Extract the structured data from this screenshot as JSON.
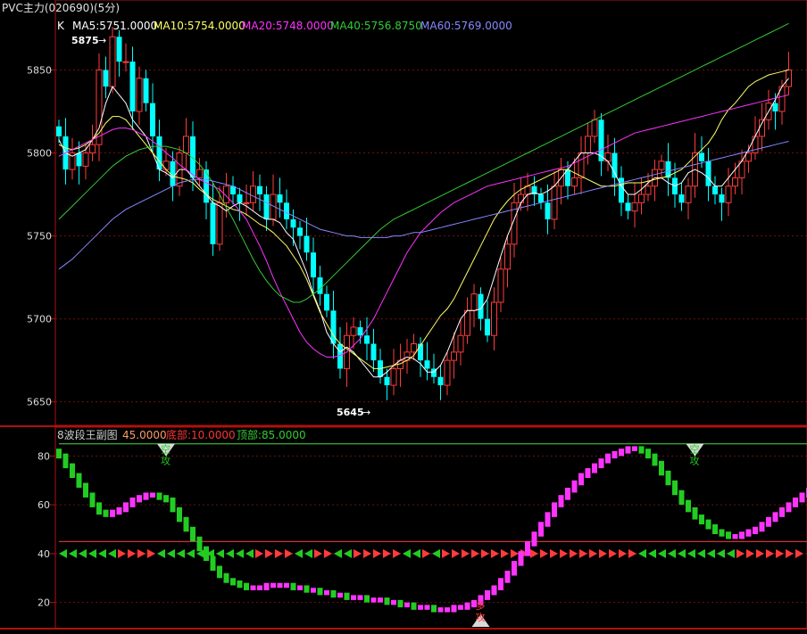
{
  "title": "PVC主力(020690)(5分)",
  "colors": {
    "up": "#ff3b3b",
    "down": "#00ffff",
    "frame": "#b01010",
    "grid": "#6e1010",
    "ma5": "#ffffff",
    "ma10": "#ffff66",
    "ma20": "#ff33ff",
    "ma40": "#33cc33",
    "ma60": "#8888ff",
    "bull": "#ff33ff",
    "bear": "#22cc22",
    "level_line": "#ff4444",
    "top_line": "#44dd44"
  },
  "main_panel": {
    "k_label": "K",
    "ma_legend": [
      {
        "text": "MA5:5751.0000",
        "color": "#ffffff"
      },
      {
        "text": "MA10:5754.0000",
        "color": "#ffff66"
      },
      {
        "text": "MA20:5748.0000",
        "color": "#ff33ff"
      },
      {
        "text": "MA40:5756.8750",
        "color": "#33cc33"
      },
      {
        "text": "MA60:5769.0000",
        "color": "#8888ff"
      }
    ],
    "high_marker": "5875",
    "low_marker": "5645"
  },
  "sub_panel": {
    "legend": [
      {
        "text": "8波段王副图",
        "color": "#cccccc"
      },
      {
        "text": "45.0000",
        "color": "#ff9966"
      },
      {
        "text": "底部:10.0000",
        "color": "#ff3333"
      },
      {
        "text": "顶部:85.0000",
        "color": "#33cc33"
      }
    ],
    "signals": [
      {
        "text": "空攻",
        "type": "top",
        "at_bar": 16
      },
      {
        "text": "空攻",
        "type": "top",
        "at_bar": 95
      },
      {
        "text": "多攻",
        "type": "bottom",
        "at_bar": 63
      },
      {
        "text": "多攻",
        "type": "bottom",
        "at_bar": 114
      }
    ]
  },
  "chart_data": [
    {
      "type": "candlestick",
      "title": "PVC主力(020690)(5分)",
      "y_ticks": [
        5650,
        5700,
        5750,
        5800,
        5850
      ],
      "ylim": [
        5638,
        5890
      ],
      "grid": true,
      "ohlc_note": "close prices per bar; open = previous close",
      "close": [
        5810,
        5790,
        5800,
        5792,
        5800,
        5805,
        5850,
        5840,
        5870,
        5855,
        5855,
        5825,
        5845,
        5830,
        5810,
        5790,
        5795,
        5780,
        5800,
        5810,
        5785,
        5790,
        5770,
        5745,
        5770,
        5780,
        5775,
        5770,
        5770,
        5780,
        5775,
        5760,
        5775,
        5770,
        5760,
        5755,
        5750,
        5740,
        5725,
        5715,
        5705,
        5685,
        5670,
        5690,
        5695,
        5690,
        5685,
        5675,
        5665,
        5660,
        5670,
        5675,
        5680,
        5685,
        5675,
        5670,
        5665,
        5660,
        5675,
        5680,
        5690,
        5705,
        5715,
        5700,
        5690,
        5710,
        5730,
        5745,
        5770,
        5775,
        5780,
        5775,
        5770,
        5760,
        5780,
        5790,
        5780,
        5785,
        5800,
        5810,
        5820,
        5795,
        5800,
        5785,
        5770,
        5765,
        5770,
        5775,
        5780,
        5790,
        5795,
        5785,
        5775,
        5770,
        5780,
        5800,
        5795,
        5780,
        5775,
        5770,
        5780,
        5785,
        5795,
        5800,
        5810,
        5820,
        5830,
        5825,
        5840,
        5850
      ],
      "ma5": [
        5808,
        5800,
        5798,
        5800,
        5802,
        5808,
        5815,
        5830,
        5840,
        5835,
        5830,
        5820,
        5815,
        5810,
        5800,
        5790,
        5788,
        5785,
        5790,
        5790,
        5785,
        5780,
        5775,
        5770,
        5768,
        5765,
        5768,
        5770,
        5768,
        5765,
        5762,
        5760,
        5760,
        5758,
        5752,
        5748,
        5738,
        5728,
        5715,
        5705,
        5692,
        5685,
        5680,
        5683,
        5680,
        5675,
        5670,
        5665,
        5665,
        5668,
        5672,
        5675,
        5677,
        5676,
        5673,
        5668,
        5668,
        5672,
        5680,
        5690,
        5700,
        5705,
        5705,
        5706,
        5712,
        5725,
        5738,
        5750,
        5760,
        5770,
        5775,
        5776,
        5775,
        5777,
        5780,
        5785,
        5790,
        5795,
        5800,
        5800,
        5800,
        5798,
        5795,
        5788,
        5780,
        5775,
        5775,
        5778,
        5782,
        5785,
        5785,
        5782,
        5780,
        5782,
        5788,
        5790,
        5788,
        5785,
        5780,
        5780,
        5785,
        5790,
        5795,
        5802,
        5810,
        5818,
        5825,
        5832,
        5840,
        5845
      ],
      "ma10": [
        5805,
        5803,
        5802,
        5803,
        5805,
        5808,
        5812,
        5818,
        5822,
        5822,
        5820,
        5815,
        5810,
        5805,
        5800,
        5795,
        5790,
        5786,
        5785,
        5784,
        5782,
        5778,
        5775,
        5772,
        5770,
        5768,
        5766,
        5765,
        5763,
        5760,
        5757,
        5755,
        5752,
        5748,
        5744,
        5738,
        5732,
        5724,
        5714,
        5704,
        5697,
        5690,
        5685,
        5682,
        5679,
        5676,
        5673,
        5670,
        5670,
        5671,
        5672,
        5673,
        5675,
        5678,
        5684,
        5690,
        5696,
        5702,
        5706,
        5712,
        5720,
        5728,
        5736,
        5744,
        5752,
        5760,
        5766,
        5771,
        5775,
        5778,
        5780,
        5782,
        5784,
        5786,
        5788,
        5790,
        5790,
        5788,
        5786,
        5784,
        5782,
        5780,
        5780,
        5780,
        5781,
        5782,
        5782,
        5782,
        5783,
        5784,
        5785,
        5786,
        5788,
        5790,
        5794,
        5798,
        5802,
        5806,
        5812,
        5820,
        5826,
        5830,
        5835,
        5840,
        5843,
        5845,
        5847,
        5848,
        5849,
        5850
      ],
      "ma20": [
        5798,
        5800,
        5802,
        5804,
        5806,
        5808,
        5810,
        5812,
        5814,
        5815,
        5815,
        5814,
        5812,
        5810,
        5807,
        5804,
        5800,
        5797,
        5793,
        5790,
        5787,
        5784,
        5782,
        5780,
        5778,
        5774,
        5770,
        5765,
        5760,
        5752,
        5744,
        5735,
        5725,
        5716,
        5708,
        5700,
        5692,
        5686,
        5682,
        5679,
        5677,
        5677,
        5678,
        5680,
        5684,
        5688,
        5694,
        5700,
        5708,
        5716,
        5724,
        5732,
        5740,
        5746,
        5752,
        5756,
        5760,
        5764,
        5767,
        5770,
        5772,
        5774,
        5776,
        5778,
        5780,
        5781,
        5782,
        5783,
        5784,
        5785,
        5786,
        5787,
        5788,
        5789,
        5790,
        5791,
        5792,
        5794,
        5796,
        5798,
        5800,
        5802,
        5804,
        5806,
        5808,
        5810,
        5812,
        5813,
        5814,
        5815,
        5816,
        5817,
        5818,
        5819,
        5820,
        5821,
        5822,
        5823,
        5824,
        5825,
        5826,
        5827,
        5828,
        5829,
        5830,
        5831,
        5832,
        5833,
        5834,
        5835
      ],
      "ma40": [
        5760,
        5764,
        5768,
        5772,
        5776,
        5780,
        5784,
        5788,
        5792,
        5795,
        5798,
        5800,
        5802,
        5803,
        5804,
        5804,
        5804,
        5803,
        5802,
        5800,
        5797,
        5793,
        5788,
        5782,
        5775,
        5767,
        5760,
        5752,
        5744,
        5736,
        5729,
        5723,
        5718,
        5714,
        5712,
        5710,
        5710,
        5712,
        5715,
        5718,
        5722,
        5726,
        5730,
        5734,
        5738,
        5742,
        5746,
        5750,
        5754,
        5757,
        5760,
        5762,
        5764,
        5766,
        5768,
        5770,
        5772,
        5774,
        5776,
        5778,
        5780,
        5782,
        5784,
        5786,
        5788,
        5790,
        5792,
        5794,
        5796,
        5798,
        5800,
        5802,
        5804,
        5806,
        5808,
        5810,
        5812,
        5814,
        5816,
        5818,
        5820,
        5822,
        5824,
        5826,
        5828,
        5830,
        5832,
        5834,
        5836,
        5838,
        5840,
        5842,
        5844,
        5846,
        5848,
        5850,
        5852,
        5854,
        5856,
        5858,
        5860,
        5862,
        5864,
        5866,
        5868,
        5870,
        5872,
        5874,
        5876,
        5878
      ],
      "ma60": [
        5730,
        5733,
        5736,
        5740,
        5744,
        5748,
        5752,
        5756,
        5760,
        5763,
        5766,
        5768,
        5770,
        5772,
        5774,
        5776,
        5778,
        5780,
        5782,
        5783,
        5784,
        5784,
        5784,
        5783,
        5782,
        5781,
        5780,
        5778,
        5776,
        5774,
        5772,
        5770,
        5768,
        5766,
        5764,
        5762,
        5760,
        5758,
        5756,
        5754,
        5753,
        5752,
        5751,
        5750,
        5750,
        5749,
        5749,
        5749,
        5749,
        5749,
        5750,
        5750,
        5751,
        5752,
        5752,
        5753,
        5754,
        5755,
        5756,
        5757,
        5758,
        5759,
        5760,
        5761,
        5762,
        5763,
        5764,
        5765,
        5766,
        5767,
        5768,
        5769,
        5770,
        5771,
        5772,
        5773,
        5774,
        5775,
        5776,
        5777,
        5778,
        5779,
        5780,
        5781,
        5782,
        5783,
        5784,
        5785,
        5786,
        5787,
        5788,
        5789,
        5790,
        5791,
        5792,
        5793,
        5794,
        5795,
        5796,
        5797,
        5798,
        5799,
        5800,
        5801,
        5802,
        5803,
        5804,
        5805,
        5806,
        5807
      ]
    },
    {
      "type": "bar",
      "title": "8波段王副图",
      "y_ticks": [
        20,
        40,
        60,
        80
      ],
      "ylim": [
        10,
        90
      ],
      "reference_lines": [
        45,
        85
      ],
      "values": [
        80,
        76,
        72,
        68,
        64,
        60,
        57,
        56,
        57,
        58,
        60,
        62,
        63,
        64,
        64,
        63,
        62,
        58,
        54,
        50,
        46,
        42,
        38,
        34,
        31,
        29,
        28,
        27,
        26,
        26,
        26,
        27,
        27,
        27,
        27,
        26,
        26,
        25,
        25,
        24,
        24,
        23,
        23,
        22,
        22,
        22,
        21,
        21,
        21,
        20,
        20,
        19,
        19,
        18,
        18,
        18,
        17,
        17,
        17,
        18,
        18,
        19,
        20,
        22,
        24,
        26,
        29,
        32,
        36,
        40,
        44,
        48,
        52,
        56,
        60,
        63,
        66,
        69,
        72,
        74,
        76,
        78,
        80,
        81,
        82,
        83,
        83,
        82,
        80,
        77,
        73,
        69,
        65,
        61,
        58,
        55,
        53,
        51,
        49,
        48,
        47,
        47,
        48,
        49,
        50,
        52,
        54,
        56,
        58,
        60,
        62,
        64,
        66,
        68,
        70,
        72,
        74,
        76,
        78,
        80
      ]
    }
  ]
}
